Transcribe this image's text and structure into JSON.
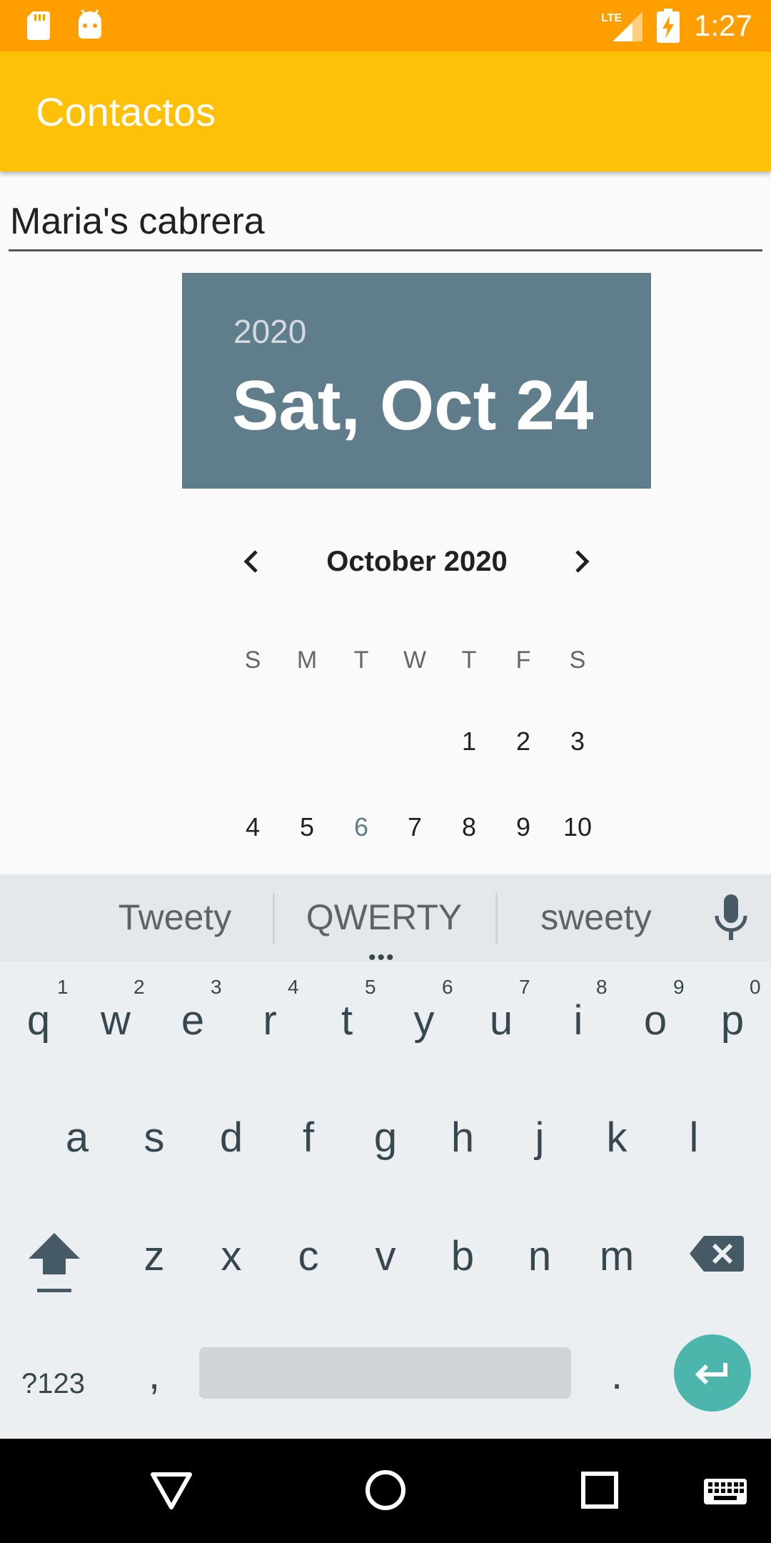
{
  "status_bar": {
    "time": "1:27",
    "lte_label": "LTE",
    "icons": [
      "sd-card-icon",
      "android-debug-icon",
      "lte-signal-icon",
      "battery-charging-icon"
    ]
  },
  "app_bar": {
    "title": "Contactos"
  },
  "form": {
    "name_value": "Maria's cabrera"
  },
  "date_picker": {
    "year": "2020",
    "selected_date": "Sat, Oct 24",
    "month_label": "October 2020",
    "weekdays": [
      "S",
      "M",
      "T",
      "W",
      "T",
      "F",
      "S"
    ],
    "week1": [
      "1",
      "2",
      "3"
    ],
    "week2": [
      "4",
      "5",
      "6",
      "7",
      "8",
      "9",
      "10"
    ],
    "highlight_day": "6",
    "header_color": "#607d8b"
  },
  "keyboard": {
    "suggestions": [
      "Tweety",
      "QWERTY",
      "sweety"
    ],
    "suggestion_more": "•••",
    "row1": [
      "q",
      "w",
      "e",
      "r",
      "t",
      "y",
      "u",
      "i",
      "o",
      "p"
    ],
    "row1_hints": [
      "1",
      "2",
      "3",
      "4",
      "5",
      "6",
      "7",
      "8",
      "9",
      "0"
    ],
    "row2": [
      "a",
      "s",
      "d",
      "f",
      "g",
      "h",
      "j",
      "k",
      "l"
    ],
    "row3": [
      "z",
      "x",
      "c",
      "v",
      "b",
      "n",
      "m"
    ],
    "symbols_key": "?123",
    "comma_key": ",",
    "period_key": ".",
    "enter_color": "#4db6ac"
  },
  "colors": {
    "status_bar": "#ff9e00",
    "app_bar": "#ffc107",
    "keyboard_bg": "#eceff1"
  }
}
